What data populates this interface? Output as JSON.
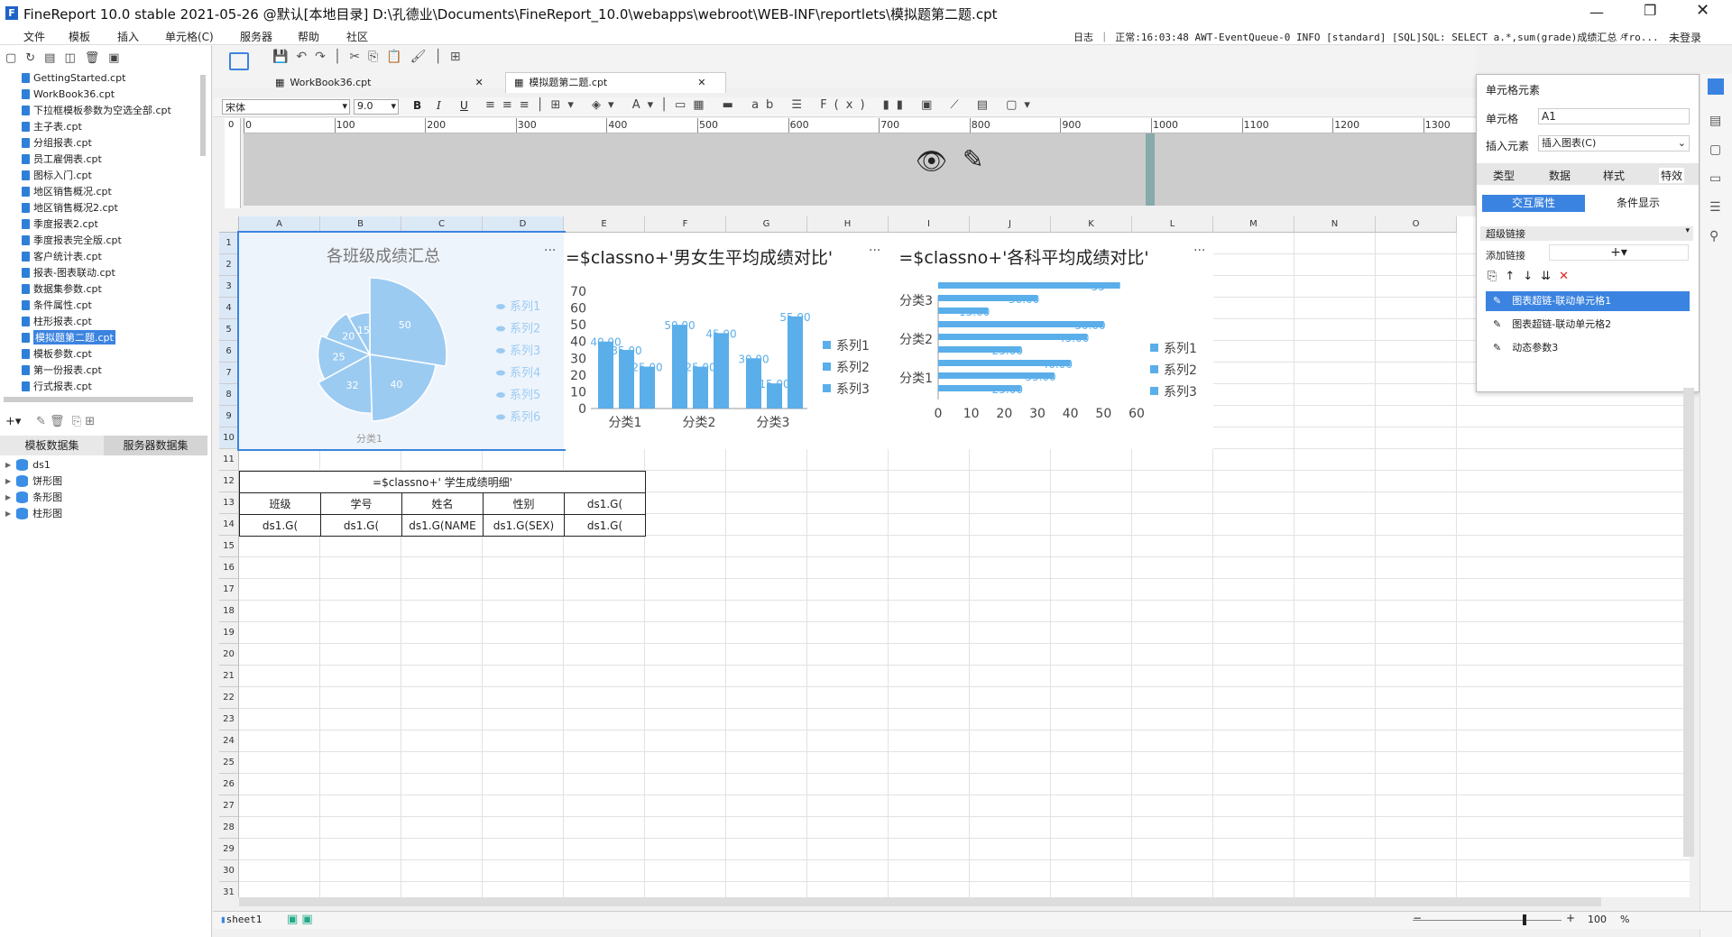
{
  "window": {
    "title": "FineReport 10.0 stable 2021-05-26 @默认[本地目录]    D:\\孔德业\\Documents\\FineReport_10.0\\webapps\\webroot\\WEB-INF\\reportlets\\模拟题第二题.cpt"
  },
  "menu": [
    "文件",
    "模板",
    "插入",
    "单元格(C)",
    "服务器",
    "帮助",
    "社区"
  ],
  "log": "日志 ｜ 正常:16:03:48 AWT-EventQueue-0 INFO [standard] [SQL]SQL: SELECT a.*,sum(grade)成绩汇总 fro...",
  "login": "未登录",
  "tree": [
    "GettingStarted.cpt",
    "WorkBook36.cpt",
    "下拉框模板参数为空选全部.cpt",
    "主子表.cpt",
    "分组报表.cpt",
    "员工雇佣表.cpt",
    "图标入门.cpt",
    "地区销售概况.cpt",
    "地区销售概况2.cpt",
    "季度报表2.cpt",
    "季度报表完全版.cpt",
    "客户统计表.cpt",
    "报表-图表联动.cpt",
    "数据集参数.cpt",
    "条件属性.cpt",
    "柱形报表.cpt",
    "模拟题第二题.cpt",
    "模板参数.cpt",
    "第一份报表.cpt",
    "行式报表.cpt"
  ],
  "tree_selected": "模拟题第二题.cpt",
  "dstabs": [
    "模板数据集",
    "服务器数据集"
  ],
  "datasets": [
    "ds1",
    "饼形图",
    "条形图",
    "柱形图"
  ],
  "tabs": [
    "WorkBook36.cpt",
    "模拟题第二题.cpt"
  ],
  "font": {
    "name": "宋体",
    "size": "9.0"
  },
  "ruler": [
    "0",
    "100",
    "200",
    "300",
    "400",
    "500",
    "600",
    "700",
    "800",
    "900",
    "1000",
    "1100",
    "1200",
    "1300"
  ],
  "columns": [
    "A",
    "B",
    "C",
    "D",
    "E",
    "F",
    "G",
    "H",
    "I",
    "J",
    "K",
    "L",
    "M",
    "N",
    "O"
  ],
  "rows": [
    "1",
    "2",
    "3",
    "4",
    "5",
    "6",
    "7",
    "8",
    "9",
    "10",
    "11",
    "12",
    "13",
    "14",
    "15",
    "16",
    "17",
    "18",
    "19",
    "20",
    "21",
    "22",
    "23",
    "24",
    "25",
    "26",
    "27",
    "28",
    "29",
    "30",
    "31"
  ],
  "table": {
    "title": "=$classno+' 学生成绩明细'",
    "headers": [
      "班级",
      "学号",
      "姓名",
      "性别",
      "ds1.G("
    ],
    "row": [
      "ds1.G(",
      "ds1.G(",
      "ds1.G(NAME",
      "ds1.G(SEX)",
      "ds1.G("
    ]
  },
  "sheet": "sheet1",
  "zoom": "100",
  "zoom_unit": "%",
  "panel": {
    "title": "单元格元素",
    "cell_label": "单元格",
    "cell_value": "A1",
    "insert_label": "插入元素",
    "insert_value": "插入图表(C)",
    "tabs": [
      "类型",
      "数据",
      "样式",
      "特效"
    ],
    "subtabs": [
      "交互属性",
      "条件显示"
    ],
    "hyperlink": "超级链接",
    "addlink": "添加链接",
    "links": [
      "图表超链-联动单元格1",
      "图表超链-联动单元格2",
      "动态参数3"
    ]
  },
  "colors": {
    "accent": "#3b83e0",
    "series1": "#5aaeea",
    "pie": "#9ccbf2"
  },
  "chart_data": [
    {
      "type": "pie",
      "title": "各班级成绩汇总",
      "categories": [
        "分类1"
      ],
      "series": [
        {
          "name": "系列1",
          "values": [
            50
          ]
        },
        {
          "name": "系列2",
          "values": [
            40
          ]
        },
        {
          "name": "系列3",
          "values": [
            32
          ]
        },
        {
          "name": "系列4",
          "values": [
            25
          ]
        },
        {
          "name": "系列5",
          "values": [
            20
          ]
        },
        {
          "name": "系列6",
          "values": [
            15
          ]
        }
      ]
    },
    {
      "type": "bar",
      "title": "=$classno+'男女生平均成绩对比'",
      "categories": [
        "分类1",
        "分类2",
        "分类3"
      ],
      "ylim": [
        0,
        70
      ],
      "yticks": [
        "0",
        "10",
        "20",
        "30",
        "40",
        "50",
        "60",
        "70"
      ],
      "series": [
        {
          "name": "系列1",
          "values": [
            40,
            50,
            30
          ]
        },
        {
          "name": "系列2",
          "values": [
            35,
            25,
            15
          ]
        },
        {
          "name": "系列3",
          "values": [
            25,
            45,
            55
          ]
        }
      ],
      "labels": [
        "40.00",
        "35.00",
        "25.00",
        "50.00",
        "25.00",
        "45.00",
        "30.00",
        "15.00",
        "55.00"
      ]
    },
    {
      "type": "bar",
      "orientation": "horizontal",
      "title": "=$classno+'各科平均成绩对比'",
      "categories": [
        "分类1",
        "分类2",
        "分类3"
      ],
      "xlim": [
        0,
        60
      ],
      "xticks": [
        "0",
        "10",
        "20",
        "30",
        "40",
        "50",
        "60"
      ],
      "series": [
        {
          "name": "系列1",
          "values": [
            25,
            25,
            15
          ]
        },
        {
          "name": "系列2",
          "values": [
            35,
            45,
            30
          ]
        },
        {
          "name": "系列3",
          "values": [
            40,
            50,
            55
          ]
        }
      ],
      "labels": [
        "25.00",
        "35.00",
        "40.00",
        "25.00",
        "45.00",
        "50.00",
        "15.00",
        "30.00",
        "55"
      ]
    }
  ]
}
